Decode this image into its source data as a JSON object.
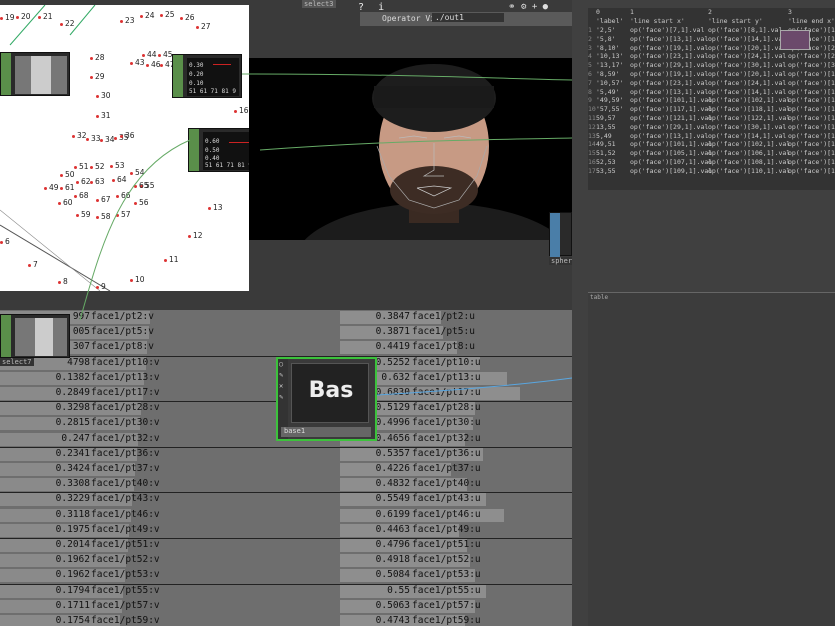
{
  "operator_viewer": {
    "label": "Operator Viewer",
    "path": "./out1"
  },
  "top_node_label": "select3",
  "diagram_points": [
    {
      "n": "19"
    },
    {
      "n": "20"
    },
    {
      "n": "21"
    },
    {
      "n": "22"
    },
    {
      "n": "23"
    },
    {
      "n": "24"
    },
    {
      "n": "25"
    },
    {
      "n": "26"
    },
    {
      "n": "27"
    },
    {
      "n": "28"
    },
    {
      "n": "29"
    },
    {
      "n": "30"
    },
    {
      "n": "31"
    },
    {
      "n": "32"
    },
    {
      "n": "33"
    },
    {
      "n": "34"
    },
    {
      "n": "35"
    },
    {
      "n": "36"
    },
    {
      "n": "43"
    },
    {
      "n": "44"
    },
    {
      "n": "45"
    },
    {
      "n": "46"
    },
    {
      "n": "47"
    },
    {
      "n": "50"
    },
    {
      "n": "51"
    },
    {
      "n": "52"
    },
    {
      "n": "53"
    },
    {
      "n": "54"
    },
    {
      "n": "55"
    },
    {
      "n": "49"
    },
    {
      "n": "61"
    },
    {
      "n": "62"
    },
    {
      "n": "63"
    },
    {
      "n": "64"
    },
    {
      "n": "65"
    },
    {
      "n": "60"
    },
    {
      "n": "68"
    },
    {
      "n": "67"
    },
    {
      "n": "66"
    },
    {
      "n": "56"
    },
    {
      "n": "59"
    },
    {
      "n": "58"
    },
    {
      "n": "57"
    },
    {
      "n": "13"
    },
    {
      "n": "12"
    },
    {
      "n": "11"
    },
    {
      "n": "10"
    },
    {
      "n": "9"
    },
    {
      "n": "8"
    },
    {
      "n": "7"
    },
    {
      "n": "6"
    },
    {
      "n": "16"
    }
  ],
  "chop1": {
    "vals": [
      "0.30",
      "0.20",
      "0.10"
    ],
    "axis": "51 61 71 81 9"
  },
  "chop2": {
    "vals": [
      "0.60",
      "0.50",
      "0.40"
    ],
    "axis": "51 61 71 81 9"
  },
  "node_labels": {
    "select7": "select7",
    "sphere": "sphere",
    "base1": "base1"
  },
  "bas_label": "Bas",
  "left_rows": [
    {
      "v": "997",
      "name": "face1/pt2:v"
    },
    {
      "v": "005",
      "name": "face1/pt5:v"
    },
    {
      "v": "307",
      "name": "face1/pt8:v"
    },
    {
      "v": "4798",
      "name": "face1/pt10:v"
    },
    {
      "v": "0.1382",
      "name": "face1/pt13:v"
    },
    {
      "v": "0.2849",
      "name": "face1/pt17:v"
    },
    {
      "v": "0.3298",
      "name": "face1/pt28:v"
    },
    {
      "v": "0.2815",
      "name": "face1/pt30:v"
    },
    {
      "v": "0.247",
      "name": "face1/pt32:v"
    },
    {
      "v": "0.2341",
      "name": "face1/pt36:v"
    },
    {
      "v": "0.3424",
      "name": "face1/pt37:v"
    },
    {
      "v": "0.3308",
      "name": "face1/pt40:v"
    },
    {
      "v": "0.3229",
      "name": "face1/pt43:v"
    },
    {
      "v": "0.3118",
      "name": "face1/pt46:v"
    },
    {
      "v": "0.1975",
      "name": "face1/pt49:v"
    },
    {
      "v": "0.2014",
      "name": "face1/pt51:v"
    },
    {
      "v": "0.1962",
      "name": "face1/pt52:v"
    },
    {
      "v": "0.1962",
      "name": "face1/pt53:v"
    },
    {
      "v": "0.1794",
      "name": "face1/pt55:v"
    },
    {
      "v": "0.1711",
      "name": "face1/pt57:v"
    },
    {
      "v": "0.1754",
      "name": "face1/pt59:v"
    }
  ],
  "right_rows": [
    {
      "v": "0.3847",
      "name": "face1/pt2:u",
      "bar": 0.38
    },
    {
      "v": "0.3871",
      "name": "face1/pt5:u",
      "bar": 0.39
    },
    {
      "v": "0.4419",
      "name": "face1/pt8:u",
      "bar": 0.44
    },
    {
      "v": "0.5252",
      "name": "face1/pt10:u",
      "bar": 0.53
    },
    {
      "v": "0.632",
      "name": "face1/pt13:u",
      "bar": 0.63
    },
    {
      "v": "0.6830",
      "name": "face1/pt17:u",
      "bar": 0.68
    },
    {
      "v": "0.5129",
      "name": "face1/pt28:u",
      "bar": 0.51
    },
    {
      "v": "0.4996",
      "name": "face1/pt30:u",
      "bar": 0.5
    },
    {
      "v": "0.4656",
      "name": "face1/pt32:u",
      "bar": 0.47
    },
    {
      "v": "0.5357",
      "name": "face1/pt36:u",
      "bar": 0.54
    },
    {
      "v": "0.4226",
      "name": "face1/pt37:u",
      "bar": 0.42
    },
    {
      "v": "0.4832",
      "name": "face1/pt40:u",
      "bar": 0.48
    },
    {
      "v": "0.5549",
      "name": "face1/pt43:u",
      "bar": 0.55
    },
    {
      "v": "0.6199",
      "name": "face1/pt46:u",
      "bar": 0.62
    },
    {
      "v": "0.4463",
      "name": "face1/pt49:u",
      "bar": 0.45
    },
    {
      "v": "0.4796",
      "name": "face1/pt51:u",
      "bar": 0.48
    },
    {
      "v": "0.4918",
      "name": "face1/pt52:u",
      "bar": 0.49
    },
    {
      "v": "0.5084",
      "name": "face1/pt53:u",
      "bar": 0.51
    },
    {
      "v": "0.55",
      "name": "face1/pt55:u",
      "bar": 0.55
    },
    {
      "v": "0.5063",
      "name": "face1/pt57:u",
      "bar": 0.51
    },
    {
      "v": "0.4743",
      "name": "face1/pt59:u",
      "bar": 0.47
    }
  ],
  "table": {
    "col_index": [
      "0",
      "1",
      "2",
      "3"
    ],
    "headers": [
      "'label'",
      "'line start x'",
      "'line start y'",
      "'line end x'"
    ],
    "rows": [
      [
        "'2,5'",
        "op('face')[7,1].val",
        "op('face')[8,1].val",
        "op('face')[1"
      ],
      [
        "'5,8'",
        "op('face')[13,1].val",
        "op('face')[14,1].val",
        "op('face')[1"
      ],
      [
        "'8,10'",
        "op('face')[19,1].val",
        "op('face')[20,1].val",
        "op('face')[2"
      ],
      [
        "'10,13'",
        "op('face')[23,1].val",
        "op('face')[24,1].val",
        "op('face')[2"
      ],
      [
        "'13,17'",
        "op('face')[29,1].val",
        "op('face')[30,1].val",
        "op('face')[3"
      ],
      [
        "'8,59'",
        "op('face')[19,1].val",
        "op('face')[20,1].val",
        "op('face')[1"
      ],
      [
        "'10,57'",
        "op('face')[23,1].val",
        "op('face')[24,1].val",
        "op('face')[1"
      ],
      [
        "'5,49'",
        "op('face')[13,1].val",
        "op('face')[14,1].val",
        "op('face')[1"
      ],
      [
        "'49,59'",
        "op('face')[101,1].val",
        "op('face')[102,1].val",
        "op('face')[1"
      ],
      [
        "'57,55'",
        "op('face')[117,1].val",
        "op('face')[118,1].val",
        "op('face')[1"
      ],
      [
        "59,57",
        "op('face')[121,1].val",
        "op('face')[122,1].val",
        "op('face')[1"
      ],
      [
        "13,55",
        "op('face')[29,1].val",
        "op('face')[30,1].val",
        "op('face')[1"
      ],
      [
        "5,49",
        "op('face')[13,1].val",
        "op('face')[14,1].val",
        "op('face')[1"
      ],
      [
        "49,51",
        "op('face')[101,1].val",
        "op('face')[102,1].val",
        "op('face')[1"
      ],
      [
        "51,52",
        "op('face')[105,1].val",
        "op('face')[106,1].val",
        "op('face')[1"
      ],
      [
        "52,53",
        "op('face')[107,1].val",
        "op('face')[108,1].val",
        "op('face')[1"
      ],
      [
        "53,55",
        "op('face')[109,1].val",
        "op('face')[110,1].val",
        "op('face')[1"
      ]
    ]
  },
  "bottom_panel_label": "table"
}
